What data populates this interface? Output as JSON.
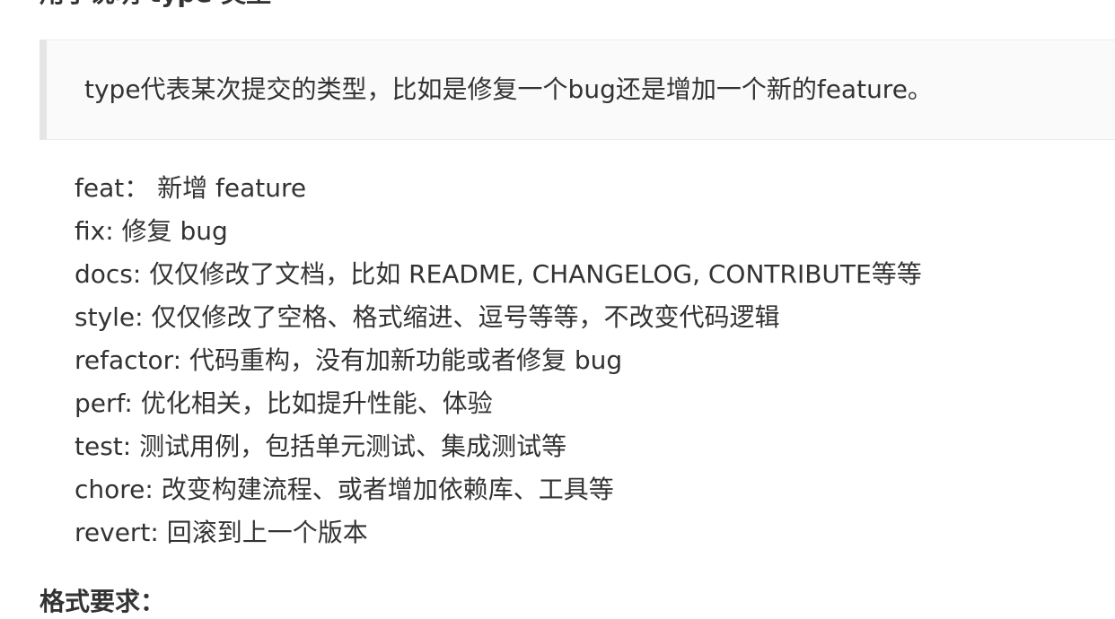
{
  "heading_partial": "用于说明 type 类型",
  "blockquote": {
    "text": "type代表某次提交的类型，比如是修复一个bug还是增加一个新的feature。"
  },
  "types": [
    {
      "text": "feat： 新增 feature"
    },
    {
      "text": "fix: 修复 bug"
    },
    {
      "text": "docs: 仅仅修改了文档，比如 README, CHANGELOG, CONTRIBUTE等等"
    },
    {
      "text": "style: 仅仅修改了空格、格式缩进、逗号等等，不改变代码逻辑"
    },
    {
      "text": "refactor: 代码重构，没有加新功能或者修复 bug"
    },
    {
      "text": "perf: 优化相关，比如提升性能、体验"
    },
    {
      "text": "test: 测试用例，包括单元测试、集成测试等"
    },
    {
      "text": "chore: 改变构建流程、或者增加依赖库、工具等"
    },
    {
      "text": "revert: 回滚到上一个版本"
    }
  ],
  "format_heading": "格式要求："
}
